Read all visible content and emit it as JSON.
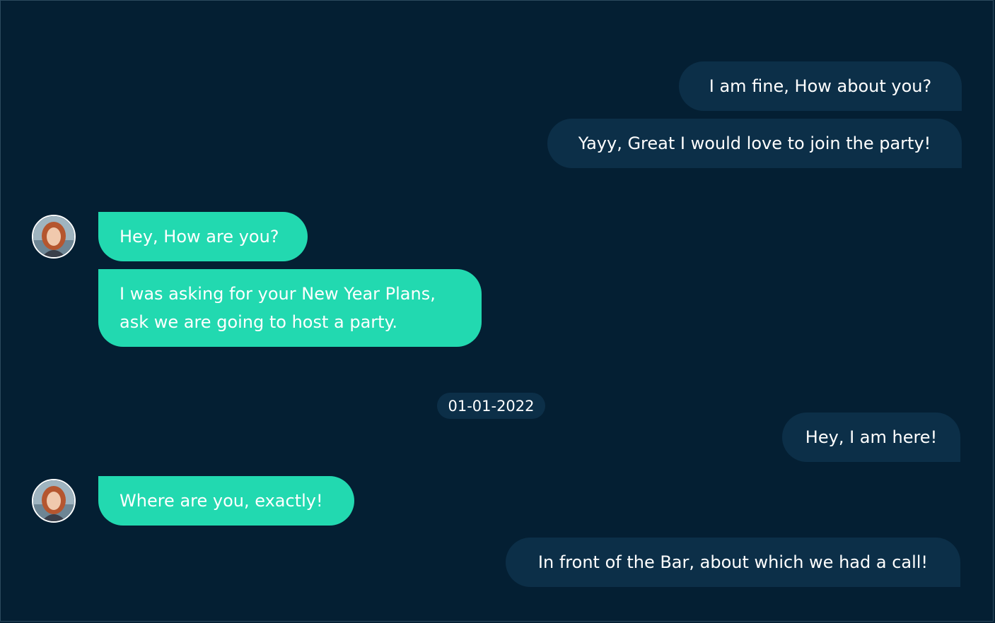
{
  "conversation": {
    "date_separator": "01-01-2022",
    "messages": [
      {
        "id": "m1",
        "direction": "outgoing",
        "text": "I am fine, How about you?"
      },
      {
        "id": "m2",
        "direction": "outgoing",
        "text": "Yayy, Great I would love to join the party!"
      },
      {
        "id": "m3",
        "direction": "incoming",
        "text": "Hey, How are you?"
      },
      {
        "id": "m4",
        "direction": "incoming",
        "text": "I was asking for your New Year Plans, ask we are going to host a party."
      },
      {
        "id": "m5",
        "direction": "outgoing",
        "text": "Hey, I am here!"
      },
      {
        "id": "m6",
        "direction": "incoming",
        "text": "Where are you, exactly!"
      },
      {
        "id": "m7",
        "direction": "outgoing",
        "text": "In front of the Bar, about which we had a call!"
      }
    ]
  },
  "theme": {
    "background": "#041f33",
    "outgoing_bubble": "#0c2f48",
    "incoming_bubble": "#22d9b0",
    "text": "#ffffff"
  },
  "icons": {
    "avatar": "contact-avatar-photo"
  }
}
